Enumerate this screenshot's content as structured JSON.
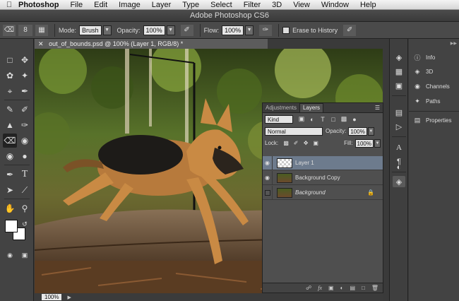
{
  "menubar": {
    "app_name": "Photoshop",
    "items": [
      "File",
      "Edit",
      "Image",
      "Layer",
      "Type",
      "Select",
      "Filter",
      "3D",
      "View",
      "Window",
      "Help"
    ]
  },
  "window": {
    "title": "Adobe Photoshop CS6"
  },
  "options": {
    "brush_size": "8",
    "mode_label": "Mode:",
    "mode_value": "Brush",
    "opacity_label": "Opacity:",
    "opacity_value": "100%",
    "flow_label": "Flow:",
    "flow_value": "100%",
    "erase_history_label": "Erase to History"
  },
  "document": {
    "tab_title": "out_of_bounds.psd @ 100% (Layer 1, RGB/8) *",
    "zoom": "100%"
  },
  "layers_panel": {
    "tabs": [
      "Adjustments",
      "Layers"
    ],
    "active_tab": "Layers",
    "filter_kind": "Kind",
    "blend_mode": "Normal",
    "opacity_label": "Opacity:",
    "opacity_value": "100%",
    "lock_label": "Lock:",
    "fill_label": "Fill:",
    "fill_value": "100%",
    "layers": [
      {
        "name": "Layer 1",
        "visible": true,
        "selected": true,
        "locked": false,
        "thumb": "transparent"
      },
      {
        "name": "Background Copy",
        "visible": true,
        "selected": false,
        "locked": false,
        "thumb": "photo"
      },
      {
        "name": "Background",
        "visible": false,
        "selected": false,
        "locked": true,
        "thumb": "photo"
      }
    ]
  },
  "right_panels": [
    "Info",
    "3D",
    "Channels",
    "Paths",
    "Properties"
  ],
  "colors": {
    "ui_dark": "#3a3a3a",
    "panel": "#4f4f4f",
    "selection": "#6d7b8d"
  }
}
